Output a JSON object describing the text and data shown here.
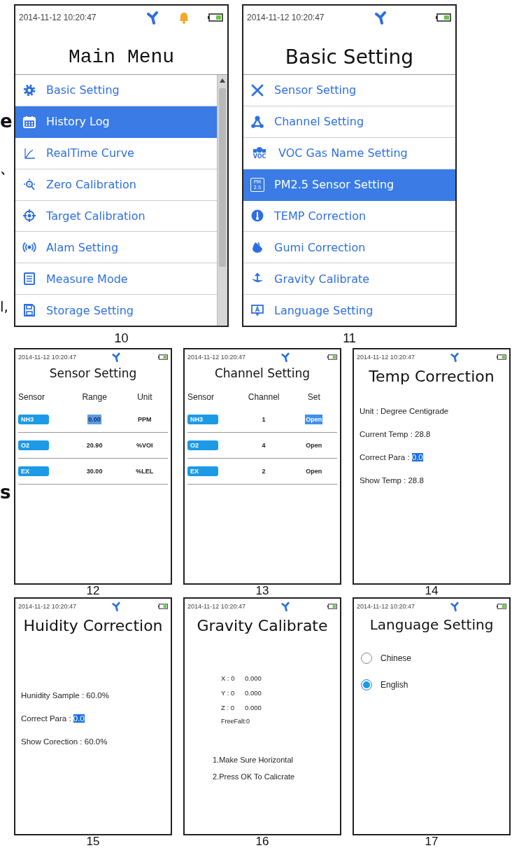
{
  "margin_fragments": [
    "e",
    "、",
    "l,",
    "s"
  ],
  "rows": [
    {
      "screens": [
        {
          "kind": "menu",
          "caption": "10",
          "status": {
            "time": "2014-11-12  10:20:47",
            "alarm": true
          },
          "title": "Main Menu",
          "items": [
            {
              "label": "Basic Setting",
              "selected": false
            },
            {
              "label": "History Log",
              "selected": true
            },
            {
              "label": "RealTime Curve",
              "selected": false
            },
            {
              "label": "Zero Calibration",
              "selected": false
            },
            {
              "label": "Target Calibration",
              "selected": false
            },
            {
              "label": "Alam Setting",
              "selected": false
            },
            {
              "label": "Measure Mode",
              "selected": false
            },
            {
              "label": "Storage Setting",
              "selected": false
            }
          ]
        },
        {
          "kind": "menu",
          "caption": "11",
          "status": {
            "time": "2014-11-12  10:20:47",
            "alarm": false
          },
          "title": "Basic Setting",
          "items": [
            {
              "label": "Sensor Setting",
              "selected": false
            },
            {
              "label": "Channel Setting",
              "selected": false
            },
            {
              "label": "VOC Gas Name Setting",
              "selected": false,
              "icon_text": "VOC"
            },
            {
              "label": "PM2.5 Sensor Setting",
              "selected": true,
              "icon_text": "PM 2.5"
            },
            {
              "label": "TEMP Correction",
              "selected": false
            },
            {
              "label": "Gumi Correction",
              "selected": false
            },
            {
              "label": "Gravity Calibrate",
              "selected": false
            },
            {
              "label": "Language Setting",
              "selected": false
            }
          ]
        }
      ]
    },
    {
      "screens": [
        {
          "kind": "table",
          "caption": "12",
          "status": {
            "time": "2014-11-12  10:20:47",
            "alarm": false
          },
          "title": "Sensor Setting",
          "columns": [
            "Sensor",
            "Range",
            "Unit"
          ],
          "rows": [
            {
              "cells": [
                {
                  "text": "NH3",
                  "selected": false
                },
                {
                  "text": "0.00",
                  "selected": true
                },
                {
                  "text": "PPM",
                  "selected": false
                }
              ]
            },
            {
              "cells": [
                {
                  "text": "O2",
                  "selected": false
                },
                {
                  "text": "20.90",
                  "selected": false
                },
                {
                  "text": "%VOI",
                  "selected": false
                }
              ]
            },
            {
              "cells": [
                {
                  "text": "EX",
                  "selected": false
                },
                {
                  "text": "30.00",
                  "selected": false
                },
                {
                  "text": "%LEL",
                  "selected": false
                }
              ]
            }
          ]
        },
        {
          "kind": "table",
          "caption": "13",
          "status": {
            "time": "2014-11-12  10:20:47",
            "alarm": false
          },
          "title": "Channel  Setting",
          "columns": [
            "Sensor",
            "Channel",
            "Set"
          ],
          "rows": [
            {
              "cells": [
                {
                  "text": "NH3",
                  "selected": false
                },
                {
                  "text": "1",
                  "selected": false
                },
                {
                  "text": "Open",
                  "selected": true
                }
              ]
            },
            {
              "cells": [
                {
                  "text": "O2",
                  "selected": false
                },
                {
                  "text": "4",
                  "selected": false
                },
                {
                  "text": "Open",
                  "selected": false
                }
              ]
            },
            {
              "cells": [
                {
                  "text": "EX",
                  "selected": false
                },
                {
                  "text": "2",
                  "selected": false
                },
                {
                  "text": "Open",
                  "selected": false
                }
              ]
            }
          ]
        },
        {
          "kind": "fields",
          "caption": "14",
          "status": {
            "time": "2014-11-12  10:20:47",
            "alarm": false
          },
          "title": "Temp Correction",
          "lines": [
            {
              "label": "Unit : ",
              "value": "Degree Centigrade",
              "selected": false
            },
            {
              "label": "Current Temp : ",
              "value": "28.8",
              "selected": false
            },
            {
              "label": "Correct Para : ",
              "value": "0.0",
              "selected": true
            },
            {
              "label": "Show Temp : ",
              "value": "28.8",
              "selected": false
            }
          ]
        }
      ]
    },
    {
      "screens": [
        {
          "kind": "fields",
          "caption": "15",
          "status": {
            "time": "2014-11-12  10:20:47",
            "alarm": false
          },
          "title": "Huidity Correction",
          "lines": [
            {
              "label": "Hunidity Sample : ",
              "value": "60.0%",
              "selected": false
            },
            {
              "label": "Correct Para : ",
              "value": "0.0",
              "selected": true
            },
            {
              "label": "Show Corection : ",
              "value": "60.0%",
              "selected": false
            }
          ]
        },
        {
          "kind": "gravity",
          "caption": "16",
          "status": {
            "time": "2014-11-12  10:20:47",
            "alarm": false
          },
          "title": "Gravity Calibrate",
          "readings": [
            {
              "axis": "X : 0",
              "value": "0.000"
            },
            {
              "axis": "Y : 0",
              "value": "0.000"
            },
            {
              "axis": "Z : 0",
              "value": "0.000"
            }
          ],
          "freefall": "FreeFalt:0",
          "steps": [
            "1.Make Sure Horizontal",
            "2.Press OK To Calicrate"
          ]
        },
        {
          "kind": "radio",
          "caption": "17",
          "status": {
            "time": "2014-11-12  10:20:47",
            "alarm": false
          },
          "title": "Language Setting",
          "options": [
            {
              "label": "Chinese",
              "selected": false
            },
            {
              "label": "English",
              "selected": true
            }
          ]
        }
      ]
    }
  ]
}
